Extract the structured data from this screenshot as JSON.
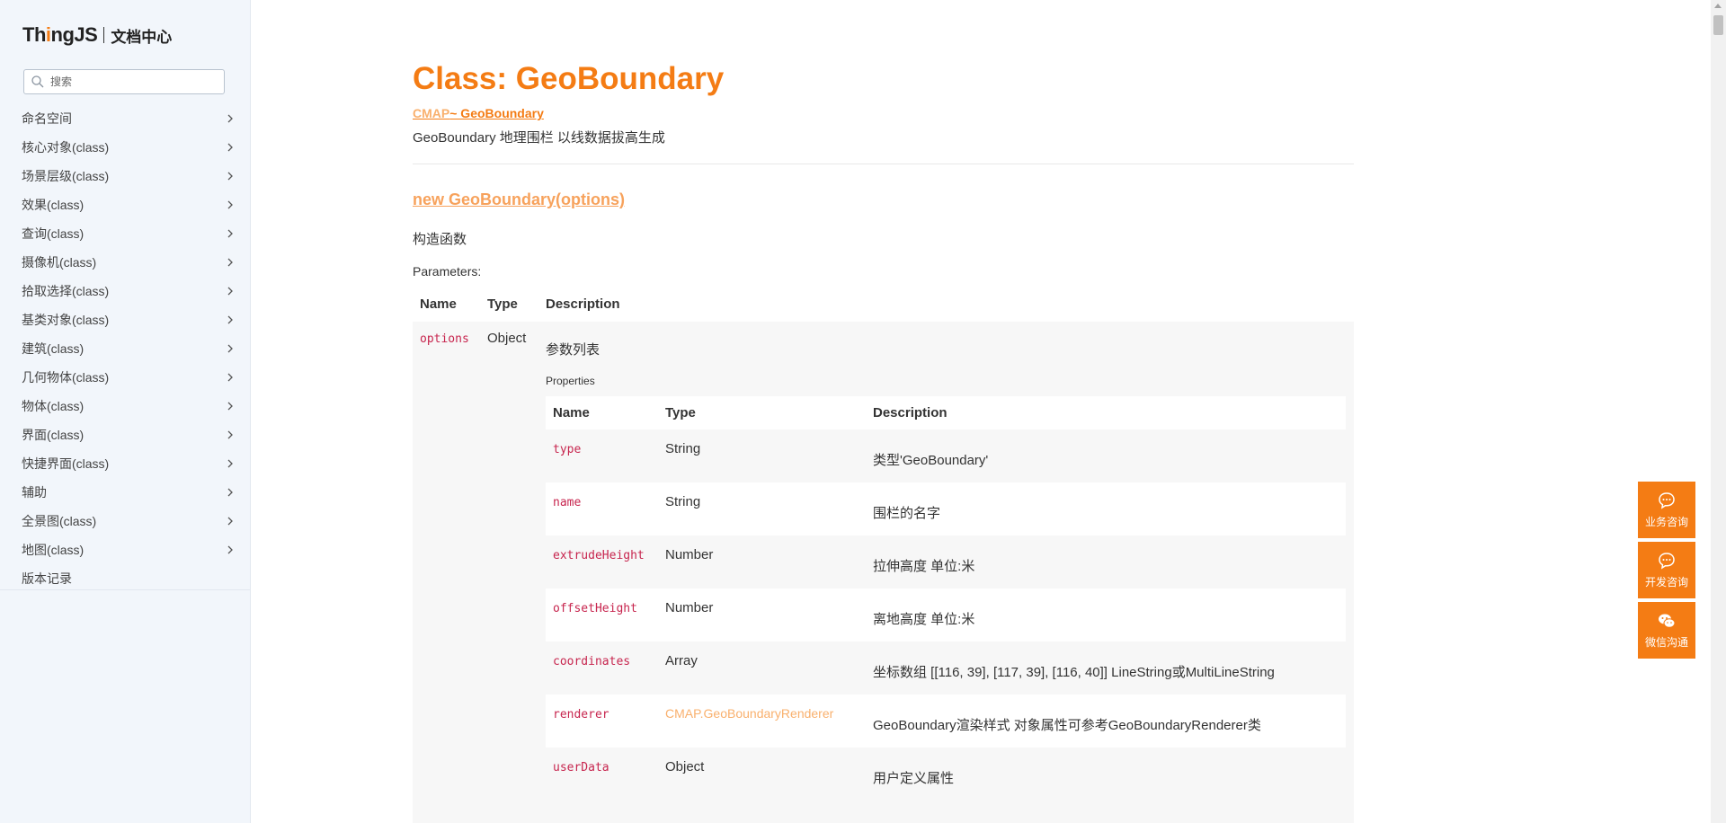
{
  "sidebar": {
    "logo_brand_pre": "Th",
    "logo_brand_i": "i",
    "logo_brand_post": "ngJS",
    "logo_subtitle": "文档中心",
    "search_placeholder": "搜索",
    "items": [
      {
        "label": "命名空间",
        "expandable": true
      },
      {
        "label": "核心对象(class)",
        "expandable": true
      },
      {
        "label": "场景层级(class)",
        "expandable": true
      },
      {
        "label": "效果(class)",
        "expandable": true
      },
      {
        "label": "查询(class)",
        "expandable": true
      },
      {
        "label": "摄像机(class)",
        "expandable": true
      },
      {
        "label": "拾取选择(class)",
        "expandable": true
      },
      {
        "label": "基类对象(class)",
        "expandable": true
      },
      {
        "label": "建筑(class)",
        "expandable": true
      },
      {
        "label": "几何物体(class)",
        "expandable": true
      },
      {
        "label": "物体(class)",
        "expandable": true
      },
      {
        "label": "界面(class)",
        "expandable": true
      },
      {
        "label": "快捷界面(class)",
        "expandable": true
      },
      {
        "label": "辅助",
        "expandable": true
      },
      {
        "label": "全景图(class)",
        "expandable": true
      },
      {
        "label": "地图(class)",
        "expandable": true
      },
      {
        "label": "版本记录",
        "expandable": false
      }
    ]
  },
  "main": {
    "title": "Class: GeoBoundary",
    "breadcrumb_ns": "CMAP",
    "breadcrumb_class": "~ GeoBoundary",
    "class_description": "GeoBoundary 地理围栏 以线数据拔高生成",
    "constructor_signature": "new GeoBoundary(options)",
    "constructor_description": "构造函数",
    "parameters_label": "Parameters:",
    "params_table": {
      "headers": [
        "Name",
        "Type",
        "Description"
      ],
      "rows": [
        {
          "name": "options",
          "type": "Object",
          "description": "参数列表",
          "properties_label": "Properties"
        }
      ]
    },
    "properties_table": {
      "headers": [
        "Name",
        "Type",
        "Description"
      ],
      "rows": [
        {
          "name": "type",
          "type": "String",
          "description": "类型'GeoBoundary'"
        },
        {
          "name": "name",
          "type": "String",
          "description": "围栏的名字"
        },
        {
          "name": "extrudeHeight",
          "type": "Number",
          "description": "拉伸高度 单位:米"
        },
        {
          "name": "offsetHeight",
          "type": "Number",
          "description": "离地高度 单位:米"
        },
        {
          "name": "coordinates",
          "type": "Array",
          "description": "坐标数组 [[116, 39], [117, 39], [116, 40]] LineString或MultiLineString"
        },
        {
          "name": "renderer",
          "type": "CMAP.GeoBoundaryRenderer",
          "description": "GeoBoundary渲染样式 对象属性可参考GeoBoundaryRenderer类"
        },
        {
          "name": "userData",
          "type": "Object",
          "description": "用户定义属性"
        }
      ]
    }
  },
  "float_widget": {
    "buttons": [
      {
        "label": "业务咨询",
        "icon": "chat-bubble-icon"
      },
      {
        "label": "开发咨询",
        "icon": "chat-bubble-icon"
      },
      {
        "label": "微信沟通",
        "icon": "wechat-icon"
      }
    ]
  },
  "colors": {
    "accent": "#f47c14",
    "accent_light": "#f9b06d",
    "code": "#c7254e",
    "sidebar_bg": "#f2f6fb"
  }
}
